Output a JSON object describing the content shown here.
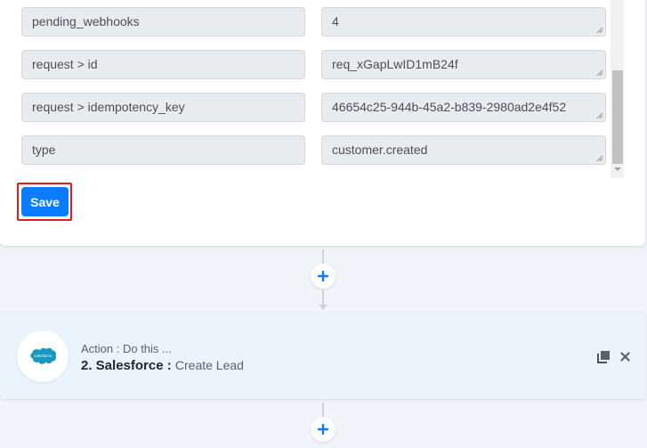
{
  "mapping_fields": [
    {
      "label": "pending_webhooks",
      "value": "4"
    },
    {
      "label": "request > id",
      "value": "req_xGapLwID1mB24f"
    },
    {
      "label": "request > idempotency_key",
      "value": "46654c25-944b-45a2-b839-2980ad2e4f52"
    },
    {
      "label": "type",
      "value": "customer.created"
    }
  ],
  "save_button": {
    "label": "Save"
  },
  "action_step": {
    "subtitle": "Action : Do this ...",
    "step_app": "2. Salesforce :",
    "step_event": "Create Lead",
    "logo_text": "salesforce",
    "logo_icon": "salesforce-cloud-icon",
    "actions": [
      "copy-icon",
      "close-icon"
    ]
  },
  "add_step_icon": "plus-icon",
  "colors": {
    "primary": "#0b7cff",
    "highlight_outline": "#e11b22",
    "salesforce_blue": "#1798c1",
    "page_bg": "#f1f4f8",
    "action_card_bg": "#ebf4fd"
  }
}
